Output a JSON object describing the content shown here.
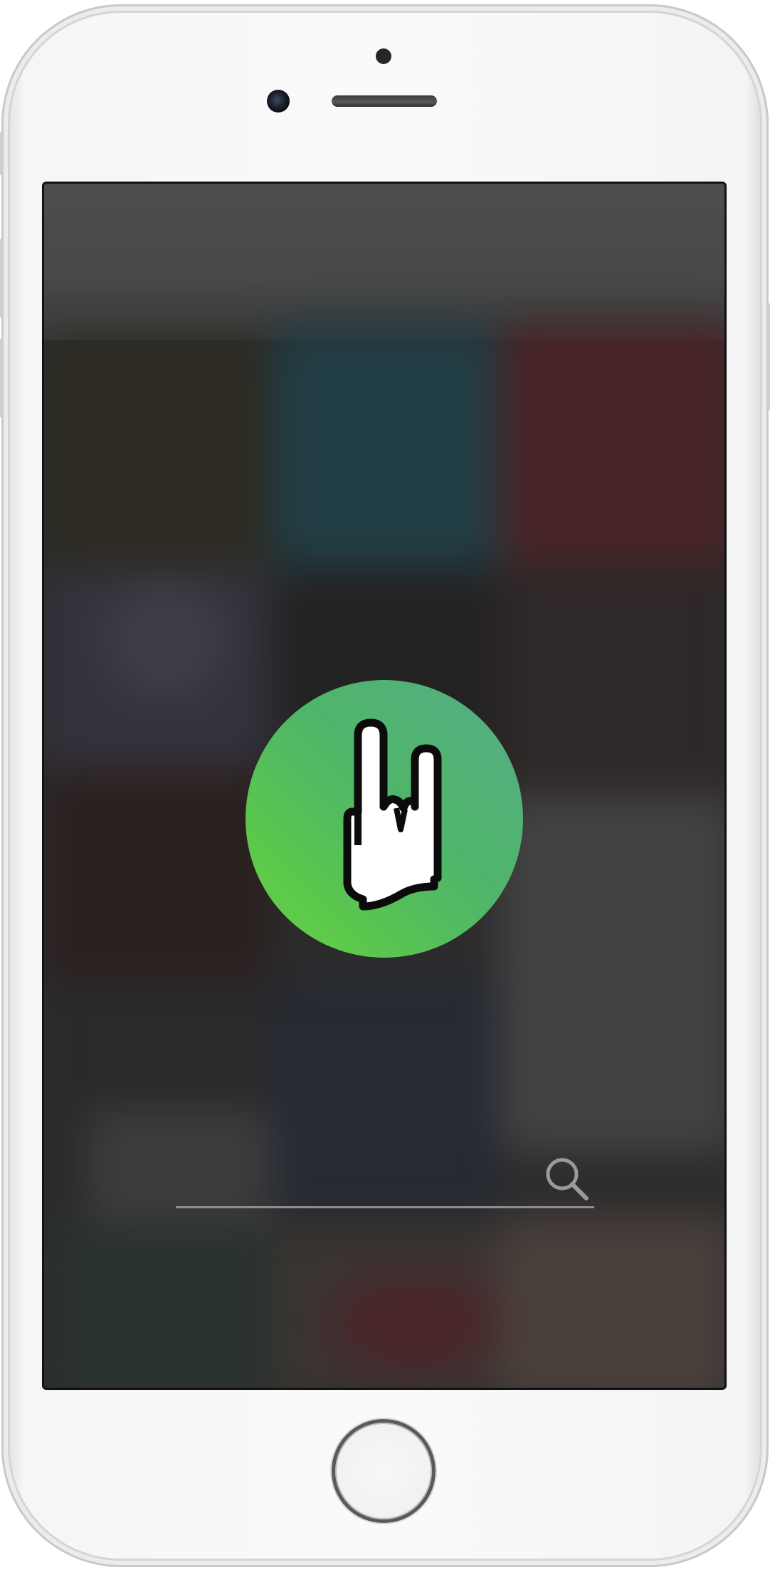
{
  "app": {
    "logo_icon": "rock-hand-icon",
    "brand_color": "#55b868"
  },
  "search": {
    "value": "",
    "placeholder": "",
    "icon": "search-icon"
  },
  "device": {
    "home_button_icon": "home-button",
    "camera_icon": "front-camera"
  }
}
